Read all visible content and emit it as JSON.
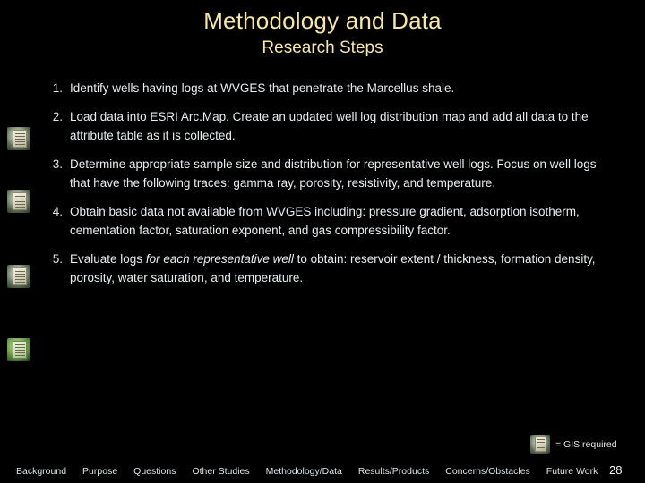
{
  "slide": {
    "title": "Methodology and Data",
    "subtitle": "Research Steps",
    "page_number": "28",
    "accent_color": "#f6e6a8",
    "background_color": "#000000",
    "steps": [
      {
        "number": "1.",
        "text": "Identify wells having logs at WVGES that penetrate the Marcellus shale.",
        "gis_required": false
      },
      {
        "number": "2.",
        "text": "Load data into ESRI Arc.Map.  Create an updated well log distribution map and add all data to the attribute table as it is collected.",
        "gis_required": true
      },
      {
        "number": "3.",
        "text": "Determine appropriate sample size and distribution for representative well logs.  Focus on well logs that have the following traces:  gamma ray, porosity, resistivity, and temperature.",
        "gis_required": true
      },
      {
        "number": "4.",
        "text": "Obtain basic data not available from WVGES including:  pressure gradient, adsorption isotherm, cementation factor, saturation exponent, and gas compressibility factor.",
        "gis_required": true
      },
      {
        "number": "5.",
        "text_pre": "Evaluate logs ",
        "text_em": "for each representative well",
        "text_post": " to obtain:  reservoir extent / thickness, formation density, porosity, water saturation, and temperature.",
        "gis_required": true
      }
    ],
    "legend": {
      "label": "= GIS required"
    },
    "footer_nav": [
      {
        "label": "Background"
      },
      {
        "label": "Purpose"
      },
      {
        "label": "Questions"
      },
      {
        "label": "Other Studies"
      },
      {
        "label": "Methodology/Data"
      },
      {
        "label": "Results/Products"
      },
      {
        "label": "Concerns/Obstacles"
      },
      {
        "label": "Future Work"
      }
    ]
  }
}
